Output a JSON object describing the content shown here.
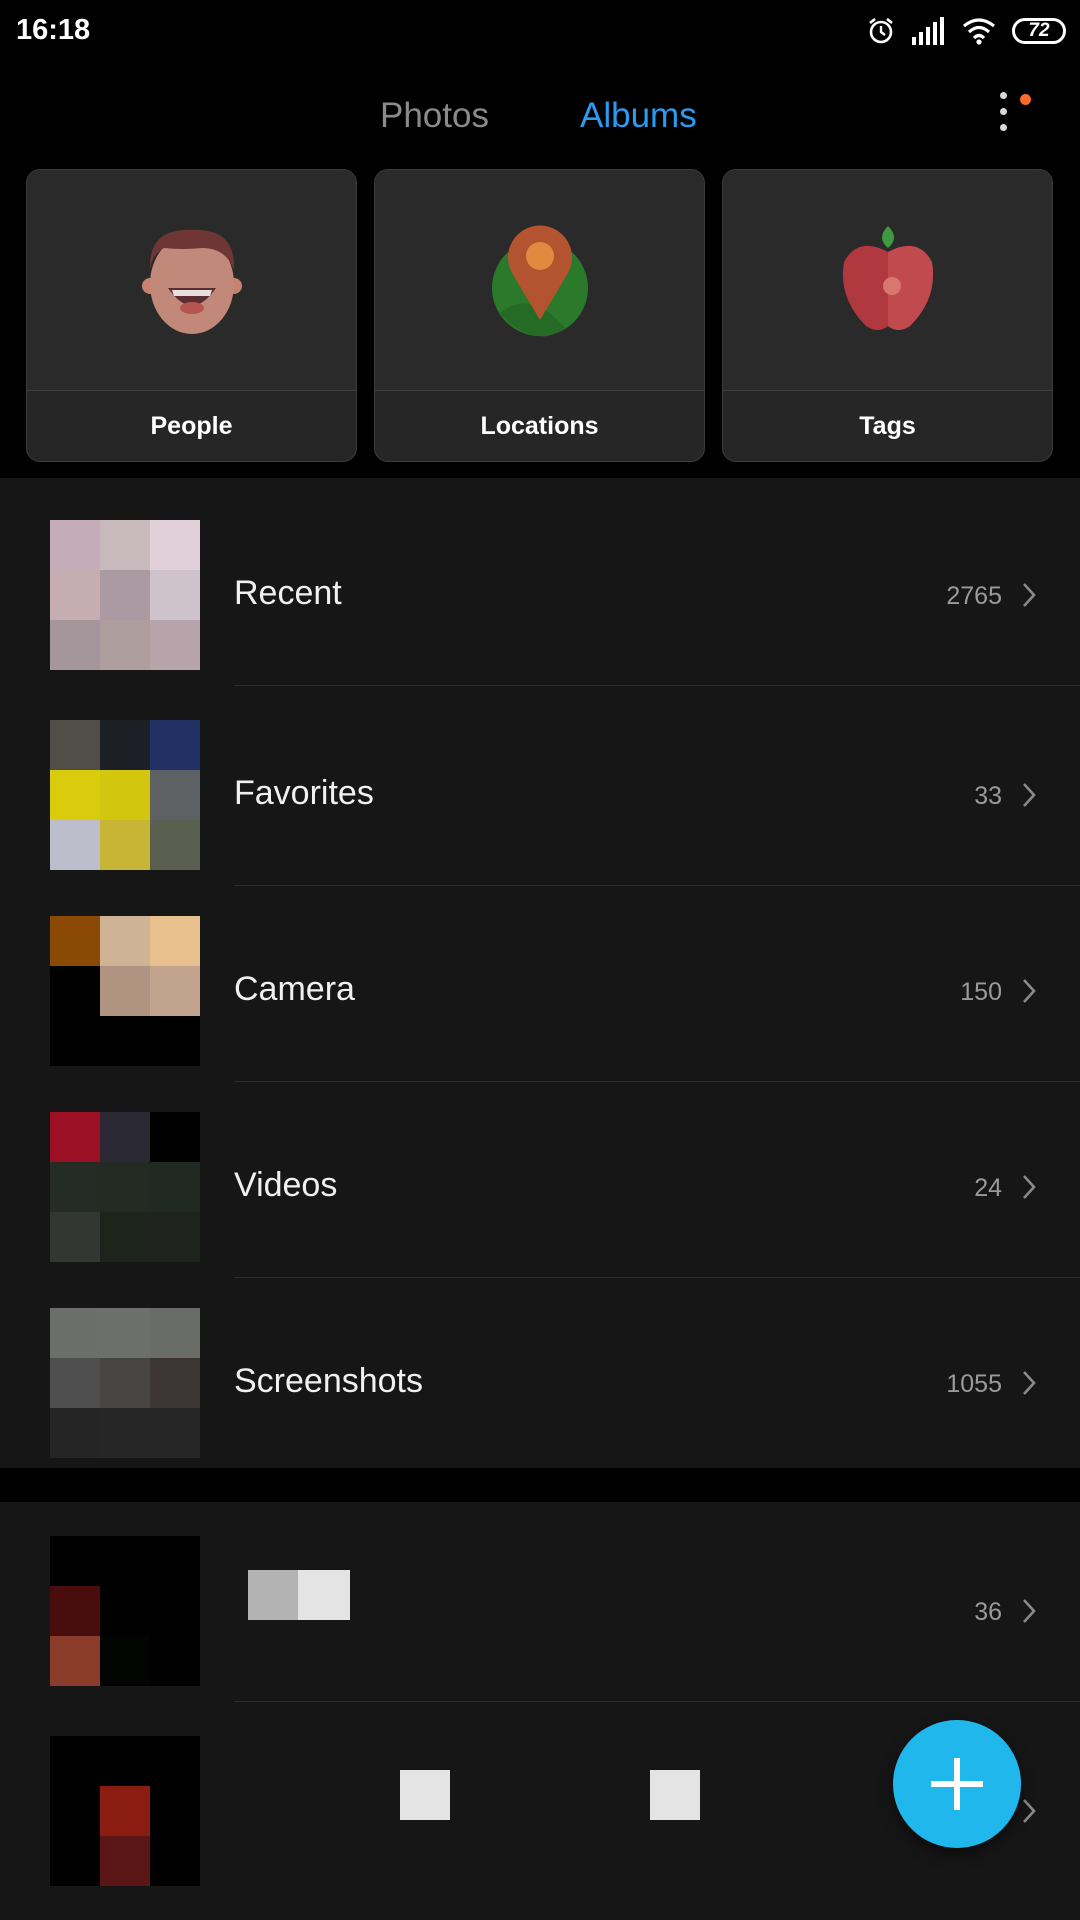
{
  "status_bar": {
    "time": "16:18",
    "battery": "72"
  },
  "header": {
    "tabs": [
      {
        "label": "Photos",
        "active": false
      },
      {
        "label": "Albums",
        "active": true
      }
    ]
  },
  "categories": [
    {
      "label": "People",
      "icon": "face-icon"
    },
    {
      "label": "Locations",
      "icon": "location-pin-icon"
    },
    {
      "label": "Tags",
      "icon": "apple-icon"
    }
  ],
  "albums": [
    {
      "label": "Recent",
      "count": "2765",
      "thumb": [
        "#c4acb8",
        "#c8babd",
        "#e2d0d8",
        "#c6adb2",
        "#ac9aa2",
        "#cec2cb",
        "#a5969b",
        "#ae9e9d",
        "#b7a4aa"
      ]
    },
    {
      "label": "Favorites",
      "count": "33",
      "thumb": [
        "#514d48",
        "#1c1f26",
        "#223063",
        "#d9cc0c",
        "#d2c70e",
        "#5e6164",
        "#bcbfcb",
        "#c7b635",
        "#5b5f50"
      ]
    },
    {
      "label": "Camera",
      "count": "150",
      "thumb": [
        "#8a4a06",
        "#ceb394",
        "#e7c08e",
        "#000000",
        "#b19381",
        "#c2a48e",
        "#000000",
        "#000000",
        "#000000"
      ]
    },
    {
      "label": "Videos",
      "count": "24",
      "thumb": [
        "#9b1024",
        "#2a2832",
        "#000000",
        "#252b25",
        "#222a22",
        "#212a22",
        "#333733",
        "#1d241c",
        "#1e241d"
      ]
    },
    {
      "label": "Screenshots",
      "count": "1055",
      "thumb": [
        "#6c6e6c",
        "#6d6f6d",
        "#6a6c6a",
        "#4e4f4e",
        "#474543",
        "#3e3535",
        "#252525",
        "#262626",
        "#262626"
      ]
    },
    {
      "label": "",
      "count": "36",
      "thumb": [
        "#000000",
        "#000000",
        "#000000",
        "#4a0d0d",
        "#000000",
        "#000000",
        "#8a3b29",
        "#020402",
        "#000000"
      ]
    },
    {
      "label": "",
      "count": "",
      "thumb": [
        "#000000",
        "#000000",
        "#000000",
        "#000000",
        "#8a1c12",
        "#000000",
        "#000000",
        "#5a1616",
        "#000000"
      ]
    }
  ],
  "fab": {
    "icon": "plus-icon"
  },
  "colors": {
    "accent": "#2a9bf2",
    "fab": "#1fb7ec",
    "notification": "#ff6a2a"
  }
}
